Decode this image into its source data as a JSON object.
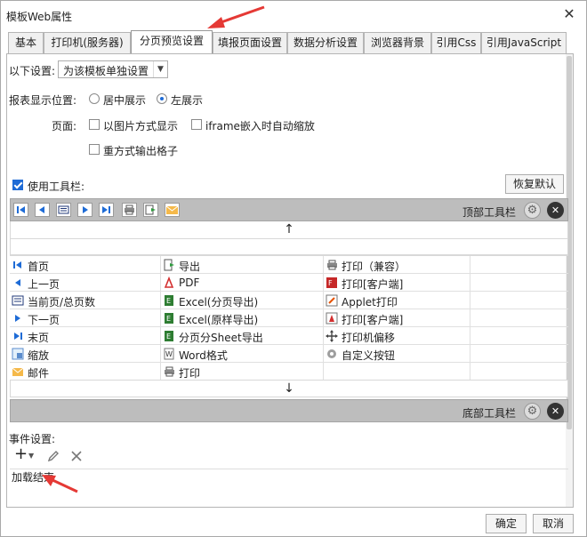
{
  "window": {
    "title": "模板Web属性",
    "close": "✕"
  },
  "tabs": [
    {
      "label": "基本"
    },
    {
      "label": "打印机(服务器)"
    },
    {
      "label": "分页预览设置",
      "active": true
    },
    {
      "label": "填报页面设置"
    },
    {
      "label": "数据分析设置"
    },
    {
      "label": "浏览器背景"
    },
    {
      "label": "引用Css"
    },
    {
      "label": "引用JavaScript"
    }
  ],
  "settings": {
    "scope_label": "以下设置:",
    "scope_value": "为该模板单独设置",
    "position_label": "报表显示位置:",
    "position_center": "居中展示",
    "position_left": "左展示",
    "position_selected": "left",
    "page_label": "页面:",
    "opt_image": "以图片方式显示",
    "opt_iframe": "iframe嵌入时自动缩放",
    "opt_grid": "重方式输出格子",
    "use_toolbar": "使用工具栏:",
    "use_toolbar_checked": true,
    "restore_default": "恢复默认"
  },
  "toolbar": {
    "top_label": "顶部工具栏",
    "bottom_label": "底部工具栏",
    "up_arrow": "↑",
    "down_arrow": "↓",
    "top_icons": [
      "first-page-icon",
      "prev-page-icon",
      "current-page-icon",
      "next-page-icon",
      "last-page-icon",
      "print-icon",
      "export-icon",
      "mail-icon"
    ]
  },
  "buttons_grid": {
    "col1": [
      {
        "label": "首页",
        "icon": "first-page-icon"
      },
      {
        "label": "上一页",
        "icon": "prev-page-icon"
      },
      {
        "label": "当前页/总页数",
        "icon": "current-page-icon"
      },
      {
        "label": "下一页",
        "icon": "next-page-icon"
      },
      {
        "label": "末页",
        "icon": "last-page-icon"
      },
      {
        "label": "缩放",
        "icon": "zoom-icon"
      },
      {
        "label": "邮件",
        "icon": "mail-icon"
      }
    ],
    "col2": [
      {
        "label": "导出",
        "icon": "export-icon"
      },
      {
        "label": "PDF",
        "icon": "pdf-icon"
      },
      {
        "label": "Excel(分页导出)",
        "icon": "excel-icon"
      },
      {
        "label": "Excel(原样导出)",
        "icon": "excel-icon"
      },
      {
        "label": "分页分Sheet导出",
        "icon": "excel-icon"
      },
      {
        "label": "Word格式",
        "icon": "word-icon"
      },
      {
        "label": "打印",
        "icon": "print-icon"
      }
    ],
    "col3": [
      {
        "label": "打印（兼容）",
        "icon": "print-icon"
      },
      {
        "label": "打印[客户端]",
        "icon": "flash-print-icon"
      },
      {
        "label": "Applet打印",
        "icon": "applet-icon"
      },
      {
        "label": "打印[客户端]",
        "icon": "pdf-print-icon"
      },
      {
        "label": "打印机偏移",
        "icon": "move-icon"
      },
      {
        "label": "自定义按钮",
        "icon": "gear-icon"
      }
    ]
  },
  "events": {
    "label": "事件设置:",
    "item": "加载结束",
    "add": "+"
  },
  "footer": {
    "ok": "确定",
    "cancel": "取消"
  },
  "colors": {
    "accent": "#1e6bd6",
    "red_arrow": "#e53935",
    "bar_bg": "#bdbdbd"
  }
}
